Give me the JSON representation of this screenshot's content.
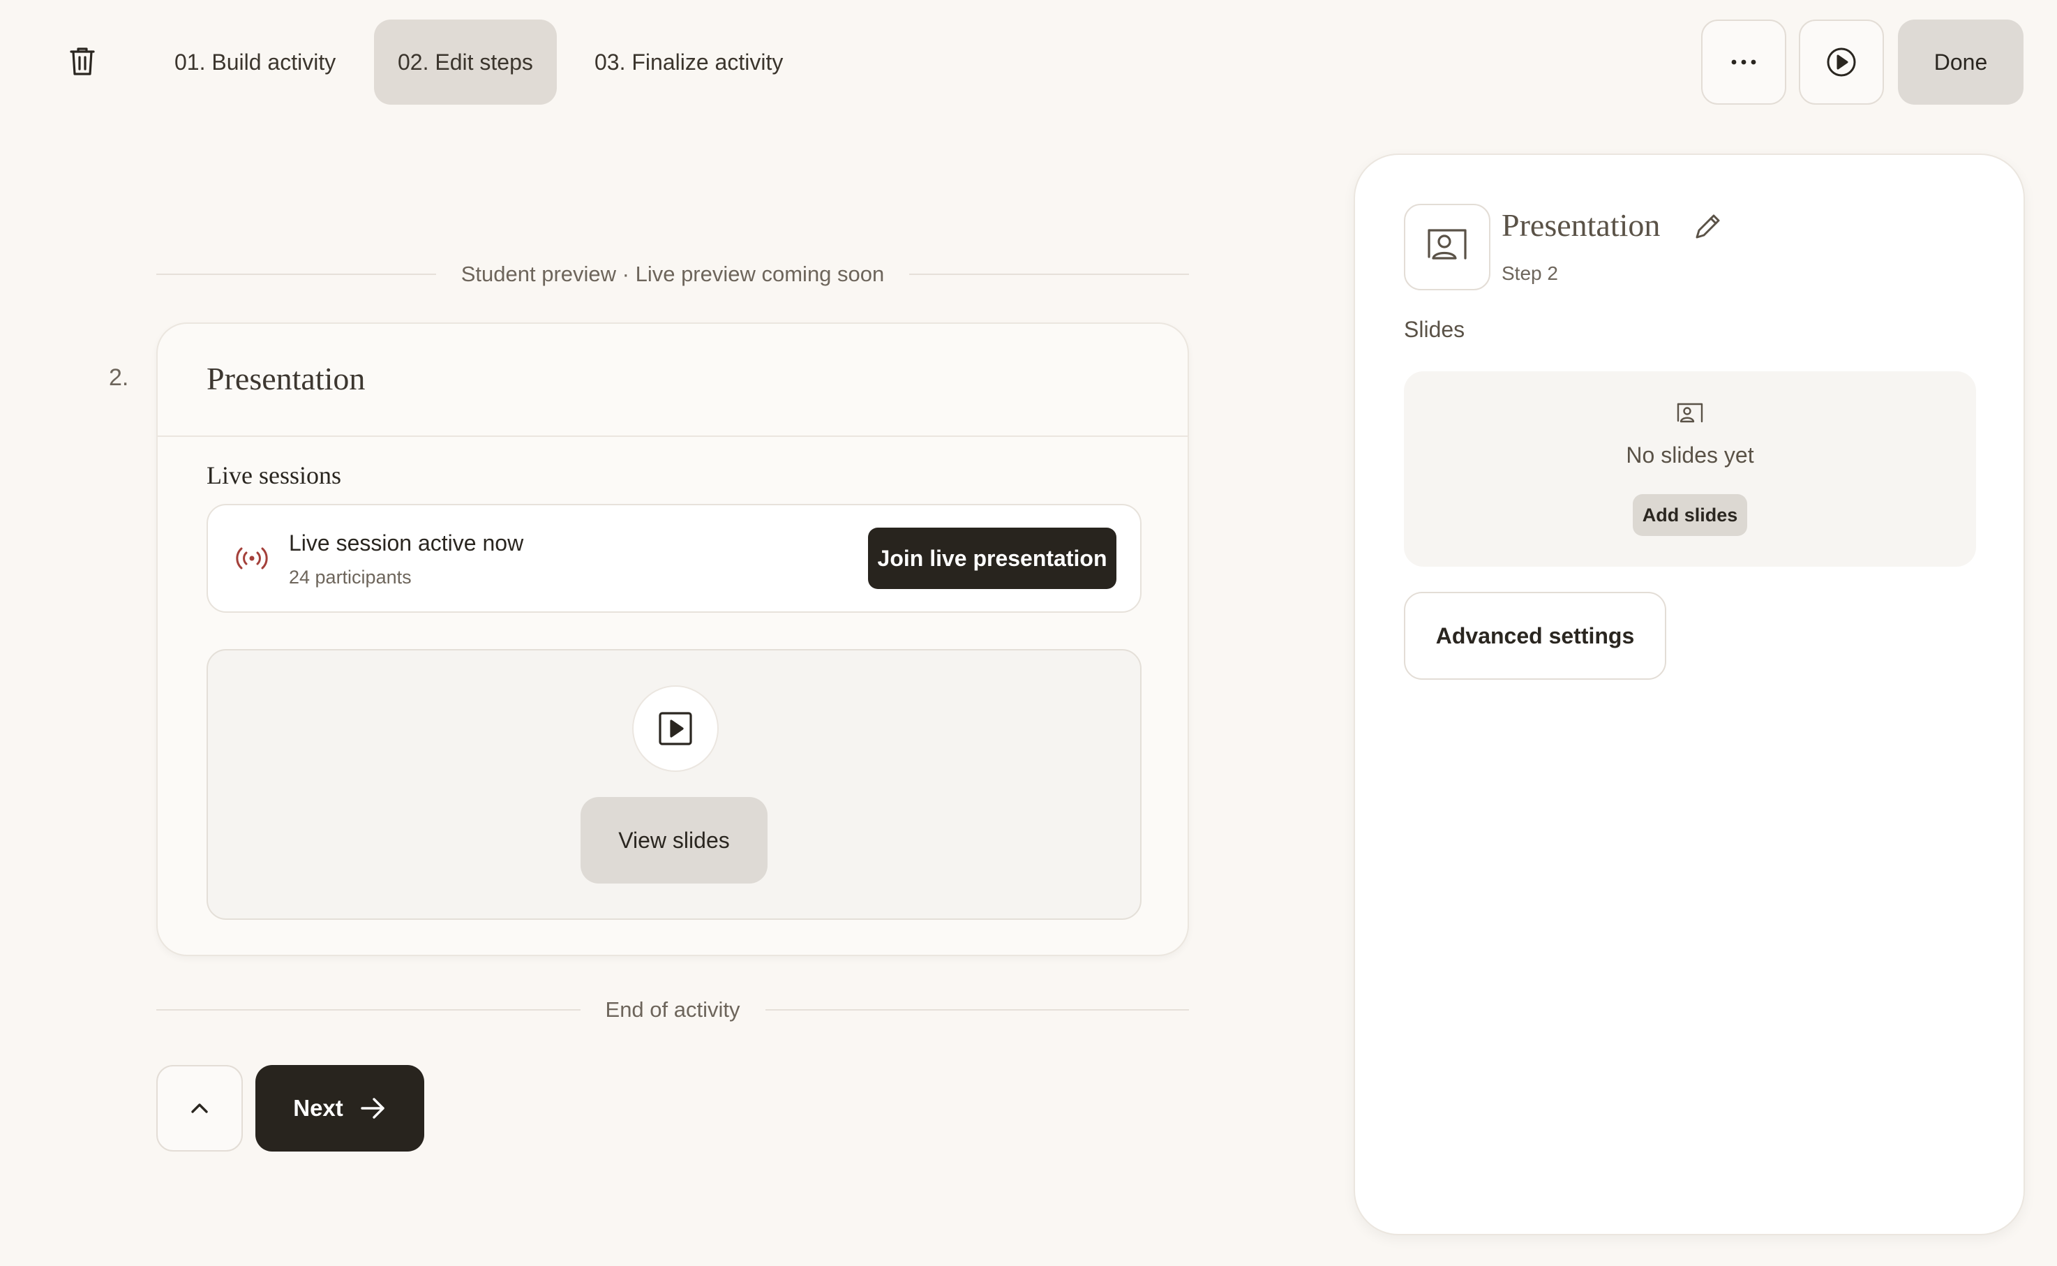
{
  "header": {
    "tabs": [
      {
        "label": "01. Build activity",
        "active": false
      },
      {
        "label": "02. Edit steps",
        "active": true
      },
      {
        "label": "03. Finalize activity",
        "active": false
      }
    ],
    "done_label": "Done",
    "icons": {
      "delete": "trash-icon",
      "more": "more-horizontal-icon",
      "preview": "play-circle-icon"
    }
  },
  "preview": {
    "divider_label": "Student preview · Live preview coming soon",
    "step_number": "2.",
    "card": {
      "title": "Presentation",
      "live_heading": "Live sessions",
      "live_session": {
        "title": "Live session active now",
        "participants": "24 participants",
        "join_label": "Join live presentation",
        "accent_color": "#a4403a"
      },
      "view_slides_label": "View slides"
    },
    "end_label": "End of activity",
    "next_label": "Next"
  },
  "panel": {
    "title": "Presentation",
    "step_label": "Step 2",
    "slides_label": "Slides",
    "empty_text": "No slides yet",
    "add_slides_label": "Add slides",
    "advanced_label": "Advanced settings"
  }
}
